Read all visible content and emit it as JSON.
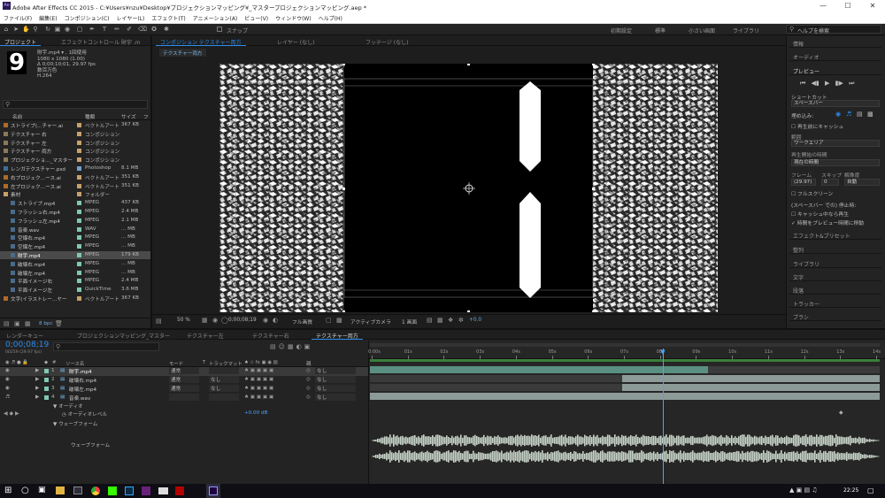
{
  "window": {
    "title": "Adobe After Effects CC 2015 - C:¥Users¥nzu¥Desktop¥プロジェクションマッピング¥_マスタープロジェクションマッピング.aep *",
    "app_icon": "Ae",
    "controls": [
      "minimize",
      "maximize",
      "close"
    ]
  },
  "menu": [
    "ファイル(F)",
    "編集(E)",
    "コンポジション(C)",
    "レイヤー(L)",
    "エフェクト(T)",
    "アニメーション(A)",
    "ビュー(V)",
    "ウィンドウ(W)",
    "ヘルプ(H)"
  ],
  "toolbar": {
    "snap_label": "スナップ",
    "workspaces": [
      "初期設定",
      "標準",
      "小さい画面",
      "ライブラリ"
    ],
    "active_workspace": "初期設定",
    "help_search_placeholder": "ヘルプを検索",
    "tools": [
      "home-icon",
      "selection-icon",
      "hand-icon",
      "zoom-icon",
      "rotate-icon",
      "camera-icon",
      "pan-icon",
      "rectangle-icon",
      "pen-icon",
      "text-icon",
      "brush-icon",
      "clone-icon",
      "eraser-icon",
      "roto-icon",
      "puppet-icon"
    ]
  },
  "project": {
    "tabs": [
      "プロジェクト",
      "エフェクトコントロール 財宇 .m"
    ],
    "thumb_char": "9",
    "info": [
      "財宇.mp4 ▾ , 1回使用",
      "1080 x 1080 (1.00)",
      "Δ 0;00;10;01, 29.97 fps",
      "数百万色",
      "H.264"
    ],
    "bpc": "8 bpc",
    "columns": [
      "名前",
      "種類",
      "サイズ",
      "フ"
    ],
    "items": [
      {
        "name": "ストライプ(...チャー.ai",
        "type": "ベクトルアート",
        "size": "367 KB",
        "color": "#c8a16a",
        "icon": "ai",
        "indent": 0
      },
      {
        "name": "テクスチャー 右",
        "type": "コンポジション",
        "size": "",
        "color": "#c8a16a",
        "icon": "comp",
        "indent": 0
      },
      {
        "name": "テクスチャー 左",
        "type": "コンポジション",
        "size": "",
        "color": "#c8a16a",
        "icon": "comp",
        "indent": 0
      },
      {
        "name": "テクスチャー 両方",
        "type": "コンポジション",
        "size": "",
        "color": "#c8a16a",
        "icon": "comp",
        "indent": 0
      },
      {
        "name": "プロジェクショ…_マスター",
        "type": "コンポジション",
        "size": "",
        "color": "#c8a16a",
        "icon": "comp",
        "indent": 0
      },
      {
        "name": "レンガテクスチャー.psd",
        "type": "Photoshop",
        "size": "8.1 MB",
        "color": "#6fa3c9",
        "icon": "psd",
        "indent": 0
      },
      {
        "name": "右プロジェク…ース.ai",
        "type": "ベクトルアート",
        "size": "351 KB",
        "color": "#c8a16a",
        "icon": "ai",
        "indent": 0
      },
      {
        "name": "左プロジェク…ース.ai",
        "type": "ベクトルアート",
        "size": "351 KB",
        "color": "#c8a16a",
        "icon": "ai",
        "indent": 0
      },
      {
        "name": "素材",
        "type": "フォルダー",
        "size": "",
        "color": "#c8a16a",
        "icon": "folder",
        "indent": 0
      },
      {
        "name": "ストライプ.mp4",
        "type": "MPEG",
        "size": "437 KB",
        "color": "#7fc8b4",
        "icon": "mp4",
        "indent": 1
      },
      {
        "name": "フラッシュ右.mp4",
        "type": "MPEG",
        "size": "2.4 MB",
        "color": "#7fc8b4",
        "icon": "mp4",
        "indent": 1
      },
      {
        "name": "フラッシュ左.mp4",
        "type": "MPEG",
        "size": "2.1 MB",
        "color": "#7fc8b4",
        "icon": "mp4",
        "indent": 1
      },
      {
        "name": "音楽.wav",
        "type": "WAV",
        "size": "... MB",
        "color": "#7fc8b4",
        "icon": "wav",
        "indent": 1
      },
      {
        "name": "空爆右.mp4",
        "type": "MPEG",
        "size": "... MB",
        "color": "#7fc8b4",
        "icon": "mp4",
        "indent": 1
      },
      {
        "name": "空爆左.mp4",
        "type": "MPEG",
        "size": "... MB",
        "color": "#7fc8b4",
        "icon": "mp4",
        "indent": 1
      },
      {
        "name": "財宇.mp4",
        "type": "MPEG",
        "size": "179 KB",
        "color": "#7fc8b4",
        "icon": "mp4",
        "indent": 1,
        "selected": true
      },
      {
        "name": "破壊右.mp4",
        "type": "MPEG",
        "size": "... MB",
        "color": "#7fc8b4",
        "icon": "mp4",
        "indent": 1
      },
      {
        "name": "破壊左.mp4",
        "type": "MPEG",
        "size": "... MB",
        "color": "#7fc8b4",
        "icon": "mp4",
        "indent": 1
      },
      {
        "name": "平面イメージ右",
        "type": "MPEG",
        "size": "2.4 MB",
        "color": "#7fc8b4",
        "icon": "mp4",
        "indent": 1
      },
      {
        "name": "平面イメージ左",
        "type": "QuickTime",
        "size": "3.6 MB",
        "color": "#7fc8b4",
        "icon": "mov",
        "indent": 1
      },
      {
        "name": "文字(イラストレー…ヤー",
        "type": "ベクトルアート",
        "size": "367 KB",
        "color": "#c8a16a",
        "icon": "ai",
        "indent": 0
      }
    ]
  },
  "composition": {
    "tabs": [
      "コンポジション テクスチャー両方",
      "レイヤー (なし)",
      "フッテージ (なし)"
    ],
    "breadcrumb": "テクスチャー両方",
    "zoom": "50 %",
    "timecode": "0;00;08;19",
    "quality": "フル画質",
    "camera": "アクティブカメラ",
    "views": "1 画面",
    "exposure": "+0.0"
  },
  "right_panel": {
    "sections_top": [
      "情報",
      "オーディオ"
    ],
    "preview": {
      "title": "プレビュー",
      "shortcut_label": "ショートカット",
      "shortcut_value": "スペースバー",
      "include_label": "埋め込み:",
      "cache_before": "再生前にキャッシュ",
      "range_label": "範囲",
      "range_value": "ワークエリア",
      "start_label": "再生開始の時間",
      "start_value": "現在の時間",
      "frame_label": "フレーム",
      "skip_label": "スキップ",
      "res_label": "解像度",
      "frame_value": "(29.97)",
      "skip_value": "0",
      "res_value": "自動",
      "fullscreen": "フルスクリーン",
      "stop_label": "(スペースバー での) 停止時:",
      "cache_range": "キャッシュ中なら再生",
      "move_time": "時間をプレビュー時間に移動"
    },
    "sections_bottom": [
      "エフェクト&プリセット",
      "整列",
      "ライブラリ",
      "文字",
      "段落",
      "トラッカー",
      "ブラシ"
    ]
  },
  "timeline": {
    "tabs": [
      "レンダーキュー",
      "プロジェクションマッピング_マスター",
      "テクスチャー左",
      "テクスチャー右",
      "テクスチャー両方"
    ],
    "active_tab": "テクスチャー両方",
    "timecode": "0;00;08;19",
    "frame_info": "00259 (29.97 fps)",
    "columns": {
      "name": "ソース名",
      "mode": "モード",
      "t": "T",
      "trkmat": "トラックマット",
      "parent": "親"
    },
    "layers": [
      {
        "num": "1",
        "name": "財宇.mp4",
        "mode": "通常",
        "trkmat": "",
        "parent": "なし",
        "selected": true,
        "color": "#7fc8b4"
      },
      {
        "num": "2",
        "name": "破壊右.mp4",
        "mode": "通常",
        "trkmat": "なし",
        "parent": "なし",
        "color": "#7fc8b4"
      },
      {
        "num": "3",
        "name": "破壊左.mp4",
        "mode": "通常",
        "trkmat": "なし",
        "parent": "なし",
        "color": "#7fc8b4"
      },
      {
        "num": "4",
        "name": "音楽.wav",
        "mode": "",
        "trkmat": "",
        "parent": "なし",
        "color": "#7fc8b4"
      }
    ],
    "audio_label": "オーディオ",
    "audio_levels_label": "オーディオレベル",
    "audio_levels_value": "+0.00 dB",
    "waveform_label": "ウェーブフォーム",
    "waveform_sub": "ウェーブフォーム",
    "ruler": [
      "0:00s",
      "01s",
      "02s",
      "03s",
      "04s",
      "05s",
      "06s",
      "07s",
      "08s",
      "09s",
      "10s",
      "11s",
      "12s",
      "13s",
      "14s"
    ],
    "playhead_fraction": 0.575
  },
  "taskbar": {
    "time": "22:25",
    "apps": [
      "windows-icon",
      "cortana-icon",
      "taskview-icon",
      "explorer-icon",
      "store-icon",
      "chrome-icon",
      "dreamweaver-icon",
      "photoshop-icon",
      "visualstudio-icon",
      "mail-icon",
      "premiere-icon",
      "aftereffects-icon"
    ]
  }
}
